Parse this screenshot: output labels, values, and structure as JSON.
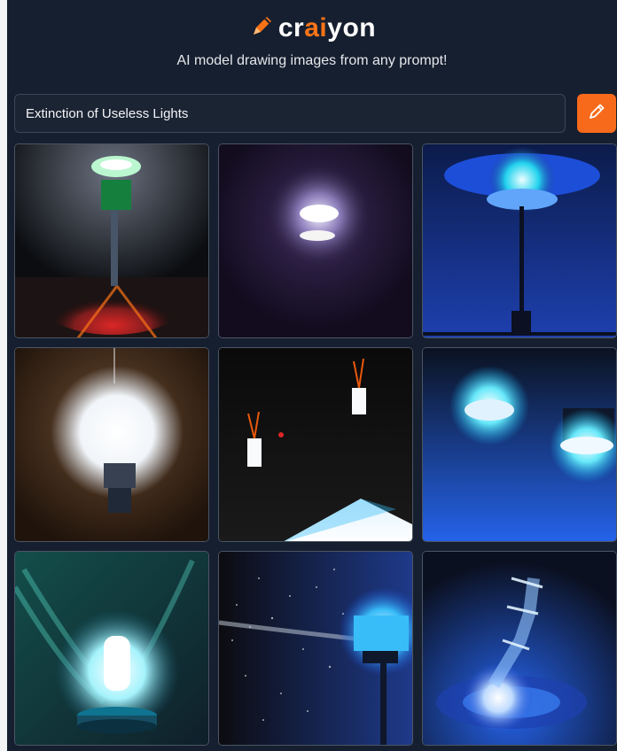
{
  "brand": {
    "part1": "cr",
    "part2": "ai",
    "part3": "yon",
    "accent": "#f97316"
  },
  "tagline": "AI model drawing images from any prompt!",
  "prompt": {
    "value": "Extinction of Useless Lights"
  },
  "draw_button": {
    "icon": "pencil-icon",
    "color": "#f76a1b"
  },
  "images": [
    {
      "subject": "green lamp on tall post over red floor"
    },
    {
      "subject": "glowing light in dark purple room"
    },
    {
      "subject": "blue lamp on thin pole"
    },
    {
      "subject": "bright bulb glowing in dark brown room"
    },
    {
      "subject": "two small candle lights in darkness"
    },
    {
      "subject": "blue lights on misty background"
    },
    {
      "subject": "glowing bulb on teal background"
    },
    {
      "subject": "blue light with sparkling particles"
    },
    {
      "subject": "blue light swirl"
    }
  ]
}
